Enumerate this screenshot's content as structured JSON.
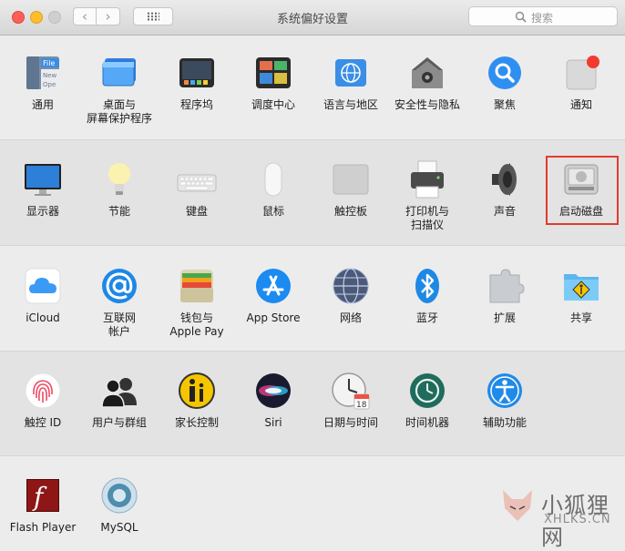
{
  "window": {
    "title": "系统偏好设置",
    "back_glyph": "‹",
    "forward_glyph": "›",
    "search_placeholder": "搜索"
  },
  "sections": [
    {
      "items": [
        {
          "label": "通用",
          "icon": "general-icon"
        },
        {
          "label": "桌面与\n屏幕保护程序",
          "icon": "desktop-screensaver-icon"
        },
        {
          "label": "程序坞",
          "icon": "dock-icon"
        },
        {
          "label": "调度中心",
          "icon": "mission-control-icon"
        },
        {
          "label": "语言与地区",
          "icon": "language-region-icon"
        },
        {
          "label": "安全性与隐私",
          "icon": "security-privacy-icon"
        },
        {
          "label": "聚焦",
          "icon": "spotlight-icon"
        },
        {
          "label": "通知",
          "icon": "notifications-icon"
        }
      ]
    },
    {
      "items": [
        {
          "label": "显示器",
          "icon": "displays-icon"
        },
        {
          "label": "节能",
          "icon": "energy-saver-icon"
        },
        {
          "label": "键盘",
          "icon": "keyboard-icon"
        },
        {
          "label": "鼠标",
          "icon": "mouse-icon"
        },
        {
          "label": "触控板",
          "icon": "trackpad-icon"
        },
        {
          "label": "打印机与\n扫描仪",
          "icon": "printers-scanners-icon"
        },
        {
          "label": "声音",
          "icon": "sound-icon"
        },
        {
          "label": "启动磁盘",
          "icon": "startup-disk-icon"
        }
      ]
    },
    {
      "items": [
        {
          "label": "iCloud",
          "icon": "icloud-icon"
        },
        {
          "label": "互联网\n帐户",
          "icon": "internet-accounts-icon"
        },
        {
          "label": "钱包与\nApple Pay",
          "icon": "wallet-applepay-icon"
        },
        {
          "label": "App Store",
          "icon": "app-store-icon"
        },
        {
          "label": "网络",
          "icon": "network-icon"
        },
        {
          "label": "蓝牙",
          "icon": "bluetooth-icon"
        },
        {
          "label": "扩展",
          "icon": "extensions-icon"
        },
        {
          "label": "共享",
          "icon": "sharing-icon"
        }
      ]
    },
    {
      "items": [
        {
          "label": "触控 ID",
          "icon": "touch-id-icon"
        },
        {
          "label": "用户与群组",
          "icon": "users-groups-icon"
        },
        {
          "label": "家长控制",
          "icon": "parental-controls-icon"
        },
        {
          "label": "Siri",
          "icon": "siri-icon"
        },
        {
          "label": "日期与时间",
          "icon": "date-time-icon"
        },
        {
          "label": "时间机器",
          "icon": "time-machine-icon"
        },
        {
          "label": "辅助功能",
          "icon": "accessibility-icon"
        }
      ]
    },
    {
      "items": [
        {
          "label": "Flash Player",
          "icon": "flash-player-icon"
        },
        {
          "label": "MySQL",
          "icon": "mysql-icon"
        }
      ]
    }
  ],
  "icon_text": {
    "general_file": "File",
    "general_new": "New",
    "general_ope": "Ope",
    "calendar_day": "18",
    "flash_letter": "f"
  },
  "highlight_color": "#e33b2e",
  "watermark": {
    "name": "小狐狸网",
    "domain": "XHLKS.CN"
  }
}
